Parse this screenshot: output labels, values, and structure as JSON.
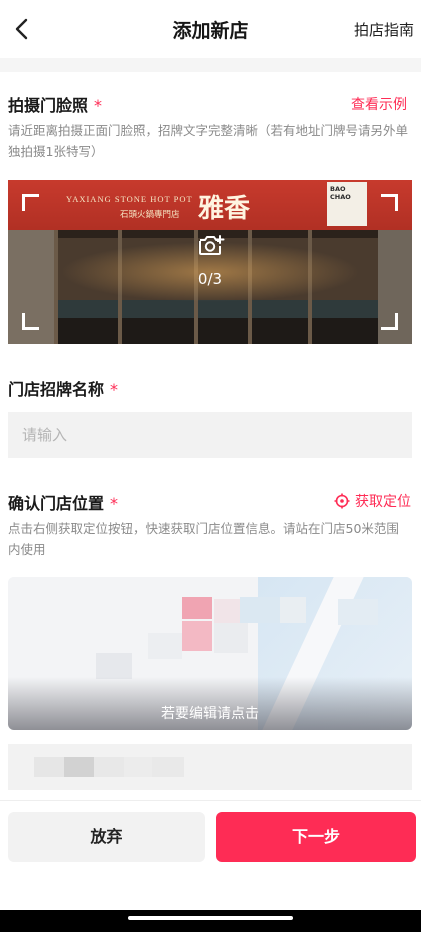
{
  "nav": {
    "title": "添加新店",
    "guide": "拍店指南",
    "back_icon": "chevron-left-icon"
  },
  "storefront": {
    "title": "拍摄门脸照",
    "required_mark": "*",
    "example_link": "查看示例",
    "hint": "请近距离拍摄正面门脸照，招牌文字完整清晰（若有地址门牌号请另外单独拍摄1张特写）",
    "photo_count": "0/3",
    "camera_icon": "camera-add-icon",
    "sign_en": "YAXIANG STONE HOT POT",
    "sign_cn_small": "石頭火鍋專門店",
    "sign_cn_big": "雅香",
    "sign_badge": "BAO CHAO"
  },
  "store_name": {
    "title": "门店招牌名称",
    "required_mark": "*",
    "placeholder": "请输入"
  },
  "location": {
    "title": "确认门店位置",
    "required_mark": "*",
    "get_location": "获取定位",
    "locate_icon": "crosshair-icon",
    "hint": "点击右侧获取定位按钮，快速获取门店位置信息。请站在门店50米范围内使用",
    "map_edit_text": "若要编辑请点击"
  },
  "footer": {
    "discard": "放弃",
    "next": "下一步"
  },
  "colors": {
    "accent": "#fe2c55",
    "field_bg": "#f2f2f2",
    "hint_text": "#8a8a8a"
  }
}
